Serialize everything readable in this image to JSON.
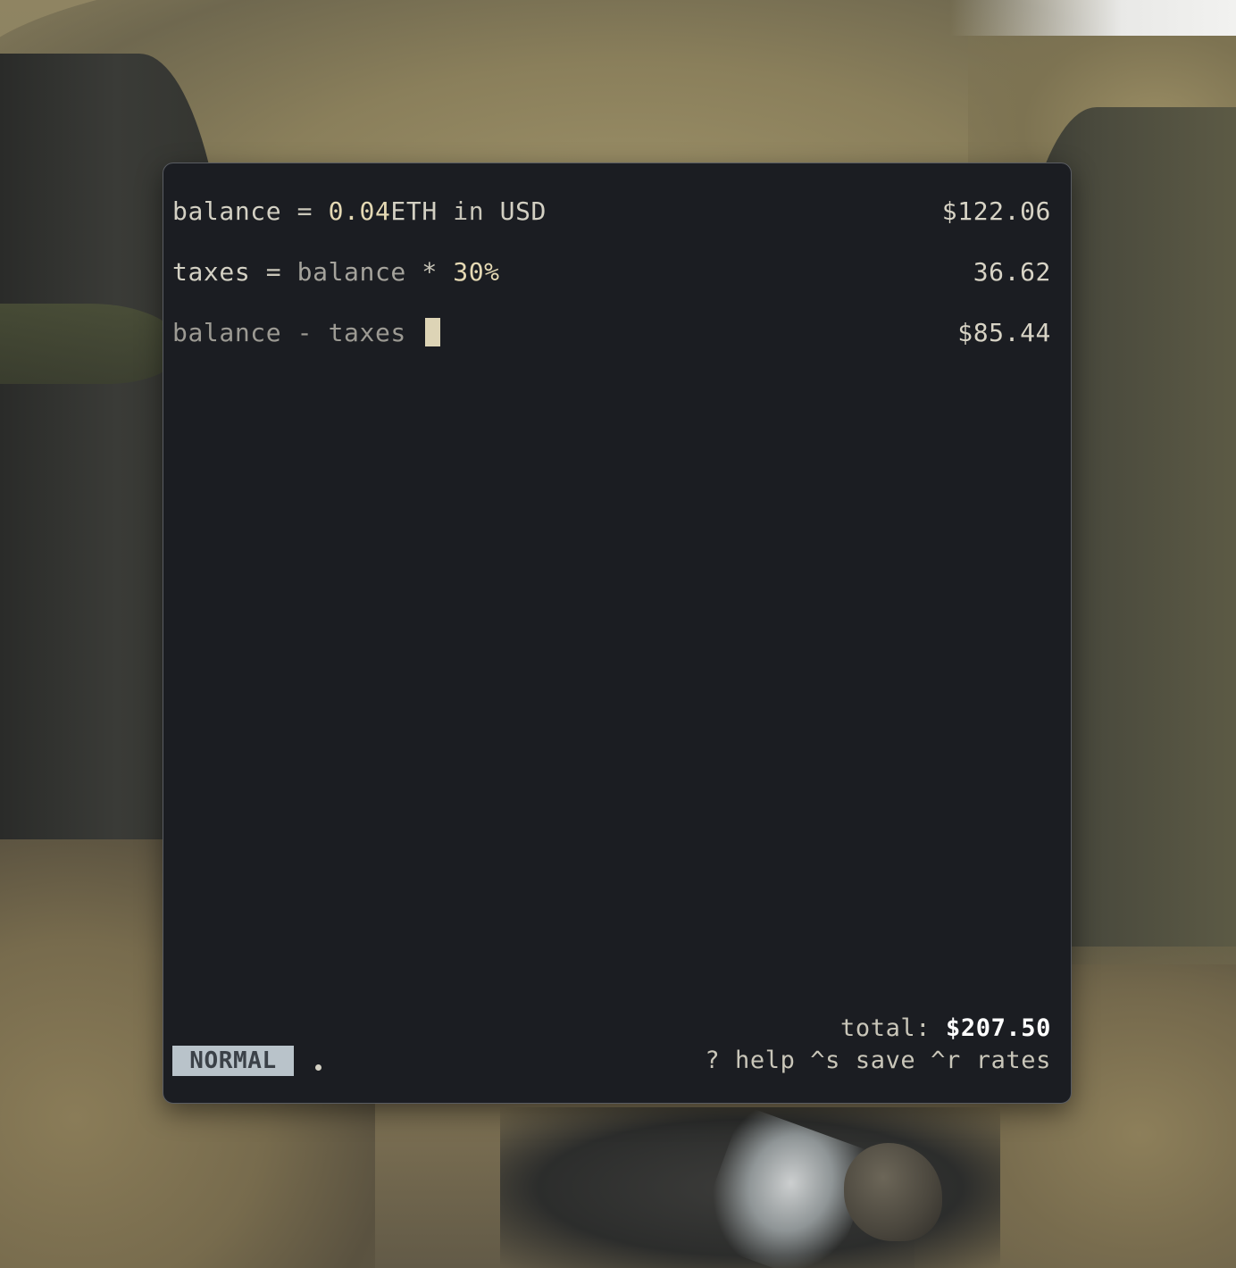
{
  "editor": {
    "lines": [
      {
        "tokens": [
          "balance",
          " = ",
          "0.04",
          "ETH",
          " in ",
          "USD"
        ],
        "result": "$122.06"
      },
      {
        "tokens": [
          "taxes",
          " = ",
          "balance",
          " * ",
          "30%"
        ],
        "result": "36.62"
      },
      {
        "tokens": [
          "balance",
          " - ",
          "taxes",
          " "
        ],
        "result": "$85.44"
      }
    ]
  },
  "status": {
    "mode": "NORMAL",
    "total_label": "total: ",
    "total_value": "$207.50",
    "hints": "? help ^s save ^r rates"
  },
  "colors": {
    "window_bg": "#1b1d22",
    "text": "#d3d0c3",
    "number": "#e5d9b4",
    "mode_badge_bg": "#b9c3ca",
    "cursor": "#ddd4b6"
  }
}
